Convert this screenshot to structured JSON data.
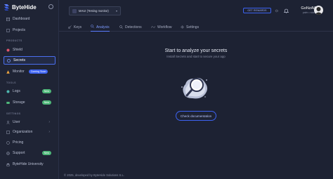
{
  "brand": {
    "name": "ByteHide"
  },
  "sidebar": {
    "top_items": [
      {
        "label": "Dashboard",
        "icon": "dashboard-icon"
      },
      {
        "label": "Projects",
        "icon": "folder-icon"
      }
    ],
    "products_label": "PRODUCTS",
    "products": [
      {
        "label": "Shield",
        "icon": "shield-icon"
      },
      {
        "label": "Secrets",
        "icon": "secrets-icon",
        "active": true
      },
      {
        "label": "Monitor",
        "icon": "monitor-icon",
        "badge": "Coming Soon"
      }
    ],
    "tools_label": "TOOLS",
    "tools": [
      {
        "label": "Logs",
        "icon": "logs-icon",
        "badge": "New"
      },
      {
        "label": "Storage",
        "icon": "storage-icon",
        "badge": "New"
      }
    ],
    "settings_label": "SETTINGS",
    "settings": [
      {
        "label": "User",
        "icon": "user-icon",
        "chevron": true
      },
      {
        "label": "Organization",
        "icon": "organization-icon",
        "chevron": true
      },
      {
        "label": "Pricing",
        "icon": "pricing-icon"
      },
      {
        "label": "Support",
        "icon": "support-icon",
        "badge": "New"
      },
      {
        "label": "ByteHide University",
        "icon": "university-icon"
      }
    ]
  },
  "topbar": {
    "app_selector": "MAUI (Testing monitor)",
    "rewards_label": "GET REWARDS",
    "user_name": "GoNzAlO",
    "user_subtitle": "palm • starter"
  },
  "tabs": [
    {
      "label": "Keys",
      "icon": "key-icon"
    },
    {
      "label": "Analysis",
      "icon": "search-icon",
      "active": true
    },
    {
      "label": "Detections",
      "icon": "detections-icon"
    },
    {
      "label": "Workflow",
      "icon": "workflow-icon"
    },
    {
      "label": "Settings",
      "icon": "gear-icon"
    }
  ],
  "empty_state": {
    "title": "Start to analyze your secrets",
    "subtitle": "Install Secrets and start to secure your app",
    "button_label": "Check documentation"
  },
  "footer": {
    "text": "© 2025, developed by ByteHide Solutions S.L."
  },
  "colors": {
    "accent": "#3d63f2",
    "badge_new": "#4fb87a",
    "background": "#1d2233"
  }
}
